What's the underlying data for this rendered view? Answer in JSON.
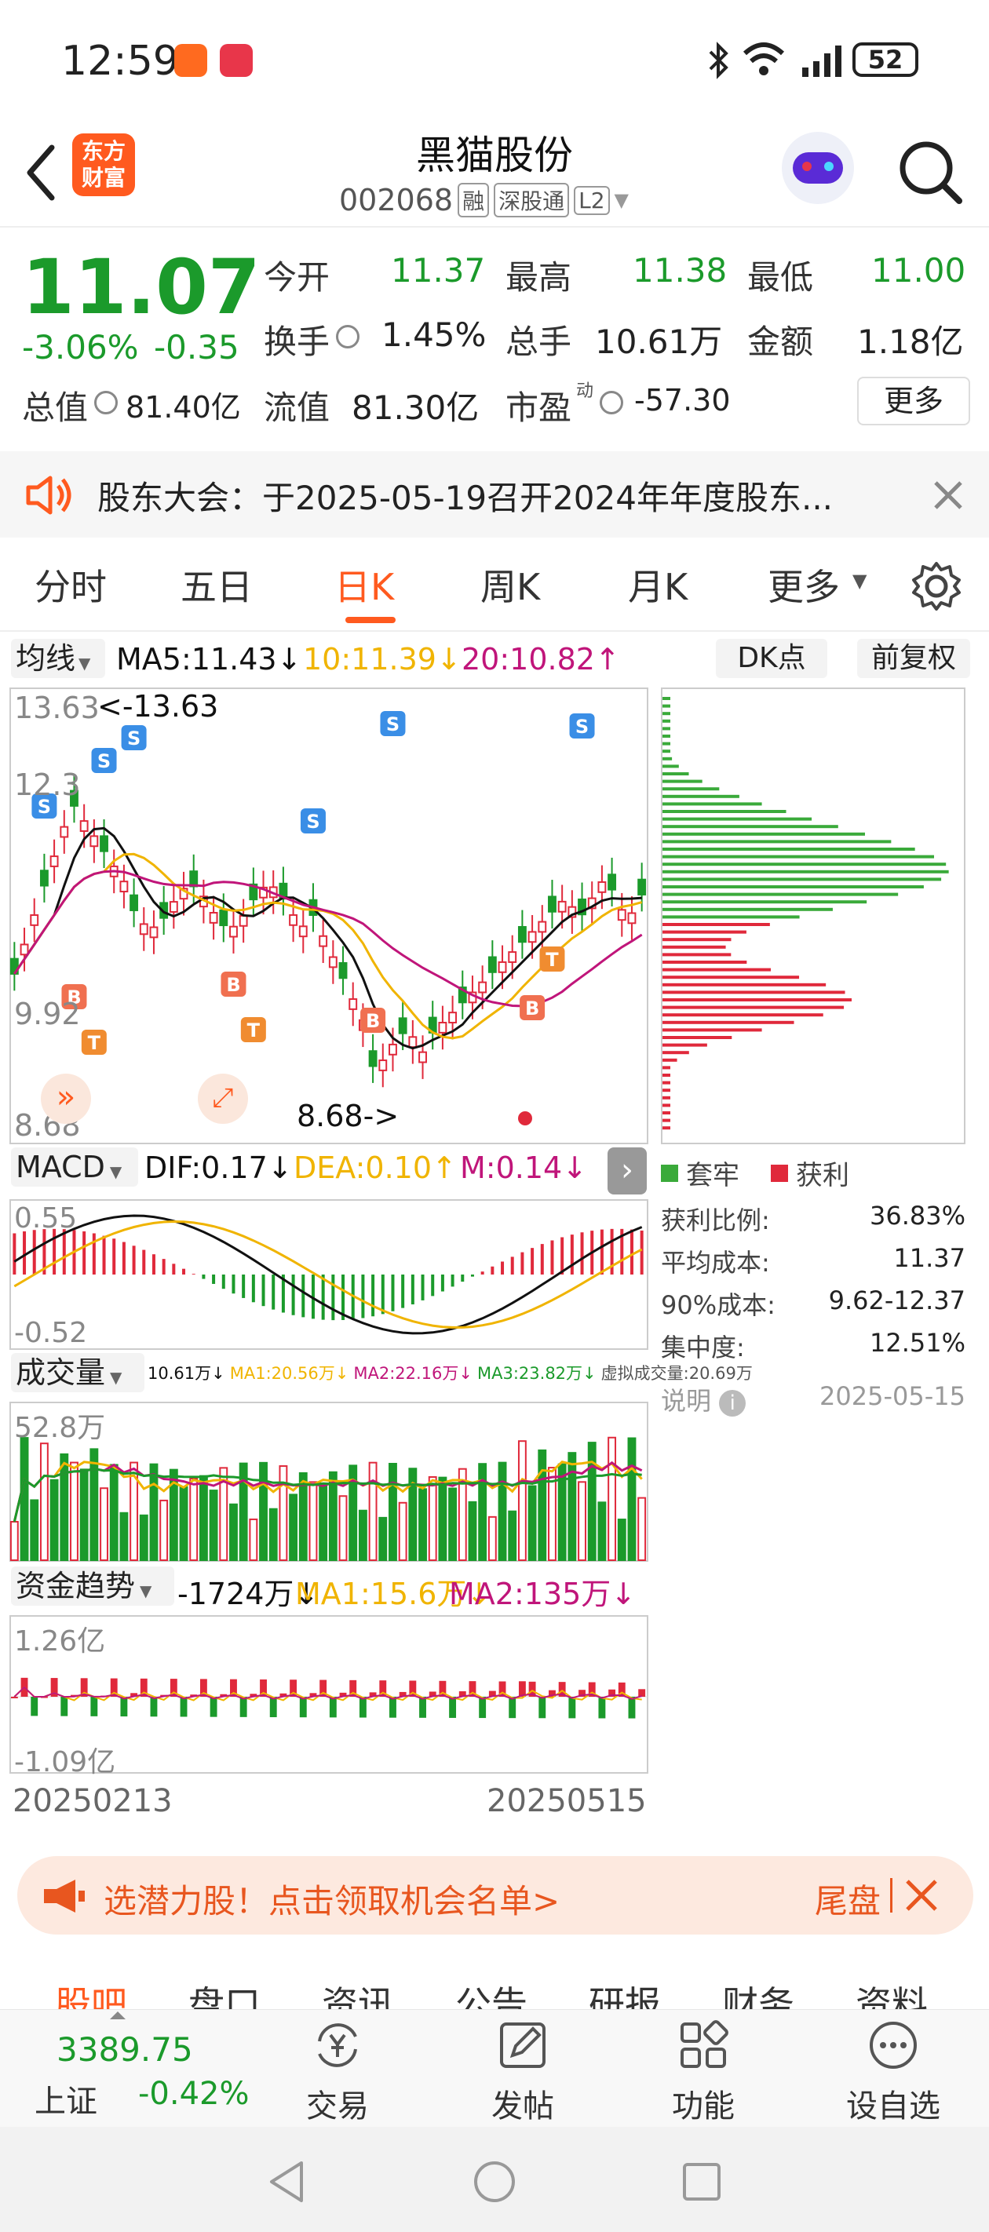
{
  "status_bar": {
    "time": "12:59",
    "battery": "52"
  },
  "header": {
    "logo_text_1": "东方",
    "logo_text_2": "财富",
    "stock_name": "黑猫股份",
    "stock_code": "002068",
    "tag_margin": "融",
    "tag_connect": "深股通",
    "tag_level": "L2"
  },
  "quote": {
    "price": "11.07",
    "change_pct": "-3.06%",
    "change_abs": "-0.35",
    "open_label": "今开",
    "open": "11.37",
    "high_label": "最高",
    "high": "11.38",
    "low_label": "最低",
    "low": "11.00",
    "turnover_label": "换手",
    "turnover": "1.45%",
    "volume_label": "总手",
    "volume": "10.61万",
    "amount_label": "金额",
    "amount": "1.18亿",
    "total_cap_label": "总值",
    "total_cap": "81.40亿",
    "float_cap_label": "流值",
    "float_cap": "81.30亿",
    "pe_label": "市盈",
    "pe_sup": "动",
    "pe": "-57.30",
    "more_button": "更多"
  },
  "notice": {
    "text": "股东大会：于2025-05-19召开2024年年度股东..."
  },
  "period_tabs": [
    "分时",
    "五日",
    "日K",
    "周K",
    "月K",
    "更多"
  ],
  "active_period": "日K",
  "ma_bar": {
    "selector": "均线",
    "ma5": "MA5:11.43↓",
    "ma10": "10:11.39↓",
    "ma20": "20:10.82↑",
    "dk_button": "DK点",
    "adjust_button": "前复权"
  },
  "kline": {
    "y_top": "13.63",
    "y_mid1": "12.3",
    "y_mid2": "9.92",
    "y_bottom": "8.68",
    "high_marker": "<-13.63",
    "low_marker": "8.68->"
  },
  "macd": {
    "selector": "MACD",
    "dif": "DIF:0.17↓",
    "dea": "DEA:0.10↑",
    "m": "M:0.14↓",
    "y_top": "0.55",
    "y_bottom": "-0.52"
  },
  "volume": {
    "selector": "成交量",
    "cur": "10.61万↓",
    "ma1": "MA1:20.56万↓",
    "ma2": "MA2:22.16万↓",
    "ma3": "MA3:23.82万↓",
    "virtual": "虚拟成交量:20.69万",
    "y_top": "52.8万"
  },
  "capital": {
    "selector": "资金趋势",
    "value": "-1724万↓",
    "ma1": "MA1:15.6万↓",
    "ma2": "MA2:135万↓",
    "y_top": "1.26亿",
    "y_bottom": "-1.09亿"
  },
  "dates": {
    "start": "20250213",
    "end": "20250515"
  },
  "chip": {
    "legend_trap": "套牢",
    "legend_profit": "获利",
    "rows": [
      {
        "label": "获利比例:",
        "value": "36.83%"
      },
      {
        "label": "平均成本:",
        "value": "11.37"
      },
      {
        "label": "90%成本:",
        "value": "9.62-12.37"
      },
      {
        "label": "集中度:",
        "value": "12.51%"
      }
    ],
    "note_label": "说明",
    "note_date": "2025-05-15"
  },
  "promo": {
    "text": "选潜力股！点击领取机会名单>",
    "tail": "尾盘"
  },
  "sub_tabs": [
    "股吧",
    "盘口",
    "资讯",
    "公告",
    "研报",
    "财务",
    "资料"
  ],
  "bottom": {
    "index_value": "3389.75",
    "index_name": "上证",
    "index_change": "-0.42%",
    "trade": "交易",
    "post": "发帖",
    "func": "功能",
    "watch": "设自选"
  },
  "colors": {
    "up": "#e0293b",
    "down": "#1b9a2b",
    "accent": "#ff5a1f",
    "ma5": "#111111",
    "ma10": "#f0b400",
    "ma20": "#c0157a"
  }
}
